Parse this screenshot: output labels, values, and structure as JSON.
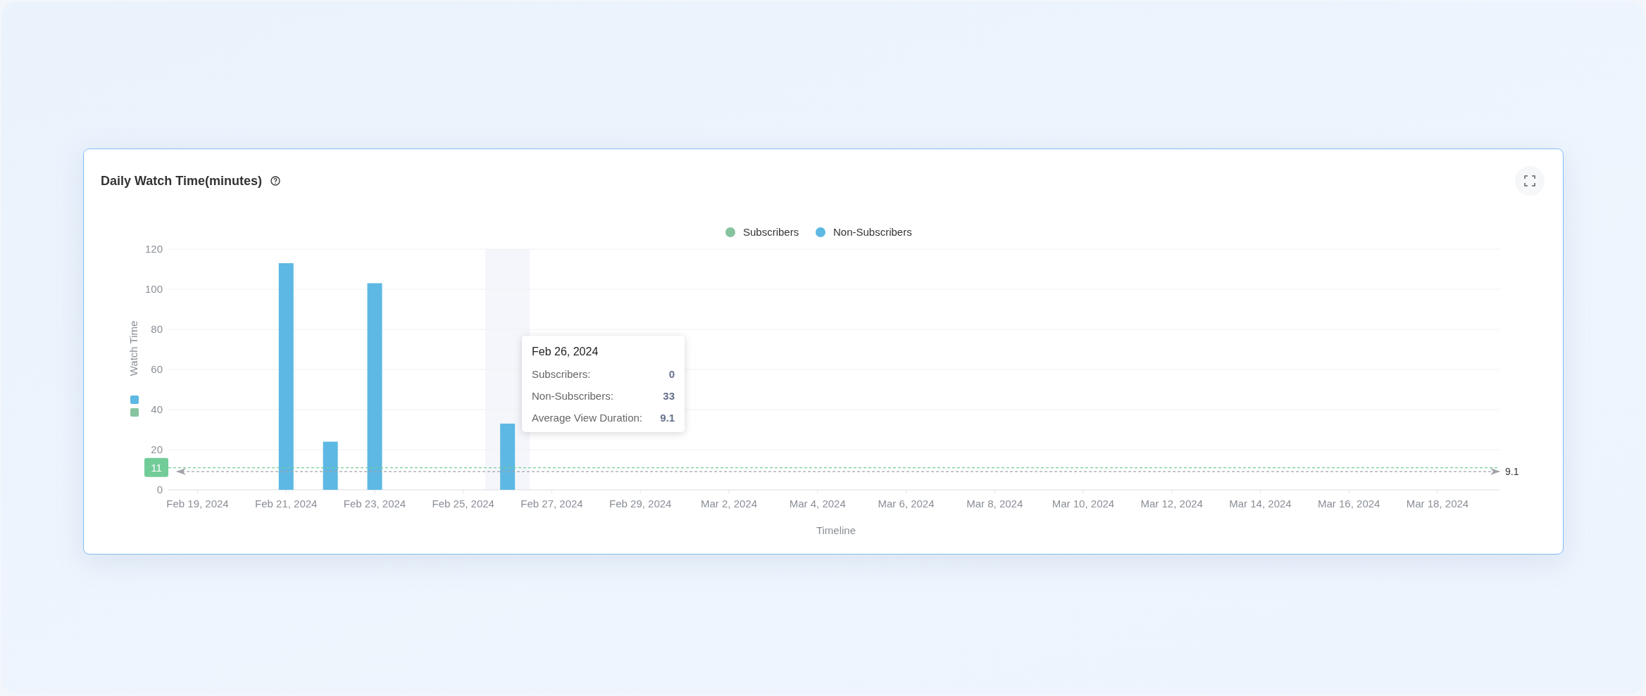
{
  "card": {
    "title": "Daily Watch Time(minutes)"
  },
  "chart_data": {
    "type": "bar",
    "stacked": true,
    "grid": true,
    "xlabel": "Timeline",
    "ylabel": "Watch Time",
    "categories": [
      "Feb 19, 2024",
      null,
      "Feb 21, 2024",
      null,
      "Feb 23, 2024",
      null,
      "Feb 25, 2024",
      null,
      "Feb 27, 2024",
      null,
      "Feb 29, 2024",
      null,
      "Mar 2, 2024",
      null,
      "Mar 4, 2024",
      null,
      "Mar 6, 2024",
      null,
      "Mar 8, 2024",
      null,
      "Mar 10, 2024",
      null,
      "Mar 12, 2024",
      null,
      "Mar 14, 2024",
      null,
      "Mar 16, 2024",
      null,
      "Mar 18, 2024",
      null
    ],
    "series": [
      {
        "name": "Subscribers",
        "color": "#86c4a0",
        "values": [
          0,
          0,
          0,
          0,
          0,
          0,
          0,
          0,
          0,
          0,
          0,
          0,
          0,
          0,
          0,
          0,
          0,
          0,
          0,
          0,
          0,
          0,
          0,
          0,
          0,
          0,
          0,
          0,
          0,
          0
        ]
      },
      {
        "name": "Non-Subscribers",
        "color": "#5db8e3",
        "values": [
          0,
          0,
          113,
          24,
          103,
          0,
          0,
          33,
          0,
          0,
          0,
          0,
          0,
          0,
          0,
          0,
          0,
          0,
          0,
          0,
          0,
          0,
          0,
          0,
          0,
          0,
          0,
          0,
          0,
          0
        ]
      }
    ],
    "ylim": [
      0,
      120
    ],
    "yticks": [
      0,
      20,
      40,
      60,
      80,
      100,
      120
    ],
    "ref_lines": [
      {
        "axis": "y",
        "value": 11,
        "label": "11",
        "color": "#72cc98"
      },
      {
        "axis": "y",
        "value": 9.1,
        "label": "9.1",
        "color": "#a0a4aa"
      }
    ]
  },
  "tooltip": {
    "title": "Feb 26, 2024",
    "rows": [
      {
        "label": "Subscribers:",
        "value": "0"
      },
      {
        "label": "Non-Subscribers:",
        "value": "33"
      },
      {
        "label": "Average View Duration:",
        "value": "9.1"
      }
    ]
  }
}
